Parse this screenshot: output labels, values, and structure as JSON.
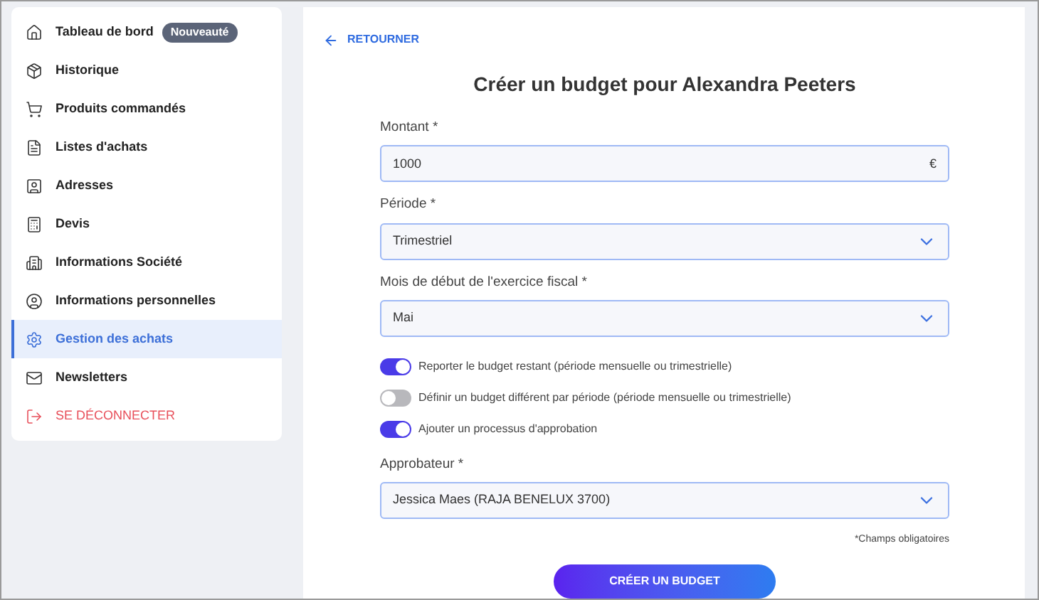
{
  "sidebar": {
    "items": [
      {
        "label": "Tableau de bord",
        "badge": "Nouveauté",
        "selected": false,
        "kind": "link"
      },
      {
        "label": "Historique",
        "selected": false,
        "kind": "link"
      },
      {
        "label": "Produits commandés",
        "selected": false,
        "kind": "link"
      },
      {
        "label": "Listes d'achats",
        "selected": false,
        "kind": "link"
      },
      {
        "label": "Adresses",
        "selected": false,
        "kind": "link"
      },
      {
        "label": "Devis",
        "selected": false,
        "kind": "link"
      },
      {
        "label": "Informations Société",
        "selected": false,
        "kind": "link"
      },
      {
        "label": "Informations personnelles",
        "selected": false,
        "kind": "link"
      },
      {
        "label": "Gestion des achats",
        "selected": true,
        "kind": "link"
      },
      {
        "label": "Newsletters",
        "selected": false,
        "kind": "link"
      },
      {
        "label": "SE DÉCONNECTER",
        "selected": false,
        "kind": "logout"
      }
    ]
  },
  "back_link": "RETOURNER",
  "title": "Créer un budget pour Alexandra Peeters",
  "fields": [
    {
      "label": "Montant *",
      "value": "1000",
      "suffix": "€",
      "kind": "text"
    },
    {
      "label": "Période *",
      "value": "Trimestriel",
      "kind": "select"
    },
    {
      "label": "Mois de début de l'exercice fiscal *",
      "value": "Mai",
      "kind": "select"
    }
  ],
  "toggles": [
    {
      "label": "Reporter le budget restant (période mensuelle ou trimestrielle)",
      "on": true
    },
    {
      "label": "Définir un budget différent par période (période mensuelle ou trimestrielle)",
      "on": false
    },
    {
      "label": "Ajouter un processus d'approbation",
      "on": true
    }
  ],
  "approver": {
    "label": "Approbateur *",
    "value": "Jessica Maes (RAJA BENELUX 3700)",
    "kind": "select"
  },
  "required_note": "*Champs obligatoires",
  "submit": "CRÉER UN BUDGET"
}
